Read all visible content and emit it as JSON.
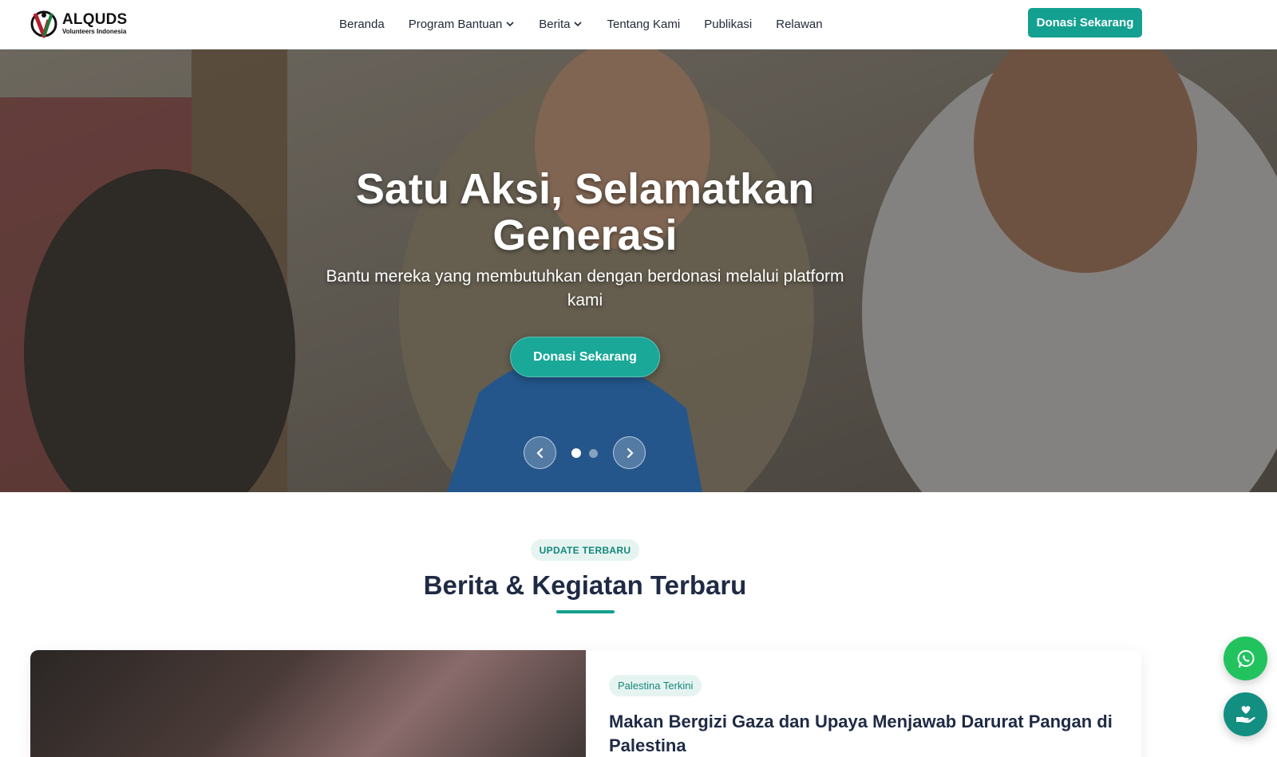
{
  "brand": {
    "name": "ALQUDS",
    "subtitle": "Volunteers Indonesia",
    "colors": {
      "primary": "#14a090",
      "dark": "#1f2a44",
      "whatsapp": "#22c35e"
    }
  },
  "nav": {
    "items": [
      {
        "label": "Beranda",
        "dropdown": false
      },
      {
        "label": "Program Bantuan",
        "dropdown": true
      },
      {
        "label": "Berita",
        "dropdown": true
      },
      {
        "label": "Tentang Kami",
        "dropdown": false
      },
      {
        "label": "Publikasi",
        "dropdown": false
      },
      {
        "label": "Relawan",
        "dropdown": false
      }
    ],
    "cta_label": "Donasi Sekarang"
  },
  "hero": {
    "title_line1": "Satu Aksi, Selamatkan",
    "title_line2": "Generasi",
    "subtitle_line1": "Bantu mereka yang membutuhkan dengan berdonasi melalui platform",
    "subtitle_line2": "kami",
    "cta_label": "Donasi Sekarang",
    "carousel": {
      "slide_count": 2,
      "active_slide": 1,
      "prev_icon": "chevron-left-icon",
      "next_icon": "chevron-right-icon"
    }
  },
  "news_section": {
    "badge": "UPDATE TERBARU",
    "title": "Berita & Kegiatan Terbaru",
    "featured": {
      "tag": "Palestina Terkini",
      "title": "Makan Bergizi Gaza dan Upaya Menjawab Darurat Pangan di Palestina"
    }
  },
  "floating": {
    "whatsapp_icon": "whatsapp-icon",
    "donate_icon": "hand-heart-icon"
  }
}
